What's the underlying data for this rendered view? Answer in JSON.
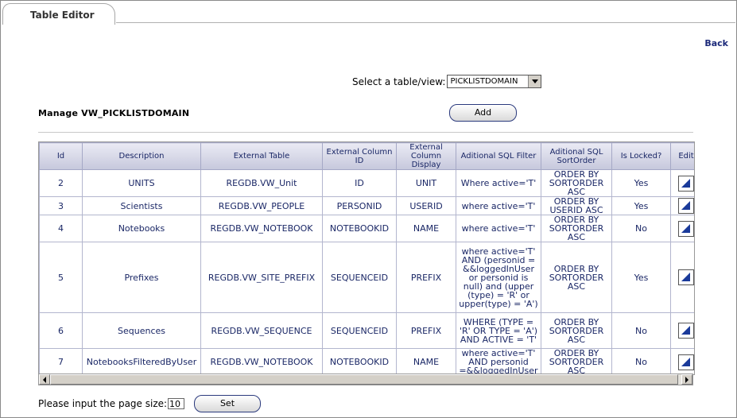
{
  "window": {
    "tab_label": "Table Editor",
    "back_label": "Back"
  },
  "selector": {
    "label": "Select a table/view:",
    "value": "PICKLISTDOMAIN"
  },
  "manage": {
    "title": "Manage VW_PICKLISTDOMAIN",
    "add_label": "Add"
  },
  "table": {
    "headers": [
      "Id",
      "Description",
      "External Table",
      "External Column ID",
      "External Column Display",
      "Aditional SQL Filter",
      "Aditional SQL SortOrder",
      "Is Locked?",
      "Edit"
    ],
    "rows": [
      [
        "2",
        "UNITS",
        "REGDB.VW_Unit",
        "ID",
        "UNIT",
        "Where active='T'",
        "ORDER BY SORTORDER ASC",
        "Yes"
      ],
      [
        "3",
        "Scientists",
        "REGDB.VW_PEOPLE",
        "PERSONID",
        "USERID",
        "where active='T'",
        "ORDER BY USERID ASC",
        "Yes"
      ],
      [
        "4",
        "Notebooks",
        "REGDB.VW_NOTEBOOK",
        "NOTEBOOKID",
        "NAME",
        "where active='T'",
        "ORDER BY SORTORDER ASC",
        "No"
      ],
      [
        "5",
        "Prefixes",
        "REGDB.VW_SITE_PREFIX",
        "SEQUENCEID",
        "PREFIX",
        "where active='T' AND (personid = &&loggedInUser or personid is null) and (upper (type) = 'R' or upper(type) = 'A')",
        "ORDER BY SORTORDER ASC",
        "Yes"
      ],
      [
        "6",
        "Sequences",
        "REGDB.VW_SEQUENCE",
        "SEQUENCEID",
        "PREFIX",
        "WHERE (TYPE = 'R' OR TYPE = 'A') AND ACTIVE = 'T'",
        "ORDER BY SORTORDER ASC",
        "No"
      ],
      [
        "7",
        "NotebooksFilteredByUser",
        "REGDB.VW_NOTEBOOK",
        "NOTEBOOKID",
        "NAME",
        "where active='T' AND personid =&&loggedInUser",
        "ORDER BY SORTORDER ASC",
        "No"
      ]
    ]
  },
  "page_size": {
    "label": "Please input the page size:",
    "value": "10",
    "set_label": "Set"
  }
}
